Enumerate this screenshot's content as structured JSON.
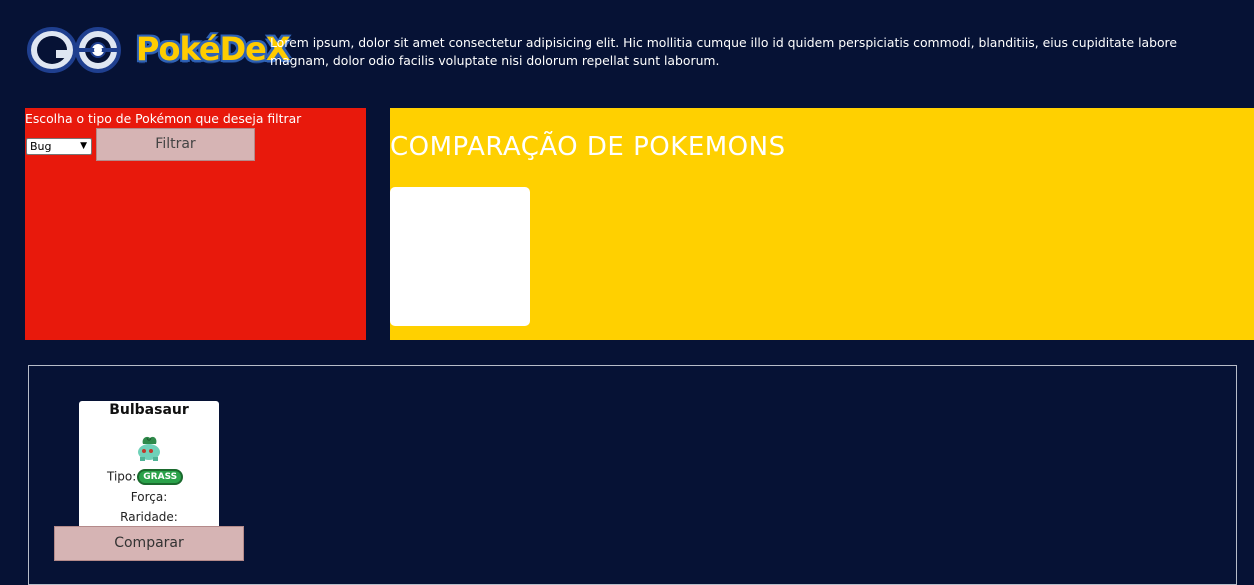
{
  "header": {
    "logo_go": "GO",
    "logo_dex": "PokéDeX",
    "intro": "Lorem ipsum, dolor sit amet consectetur adipisicing elit.  Hic mollitia cumque illo id quidem perspiciatis commodi, blanditiis, eius cupiditate labore magnam, dolor odio facilis voluptate nisi dolorum repellat sunt laborum."
  },
  "filter": {
    "label": "Escolha o tipo de  Pokémon que deseja filtrar",
    "selected_type": "Bug",
    "button_label": "Filtrar",
    "panel_color": "#e8190c"
  },
  "comparison": {
    "title": "COMPARAÇÃO DE POKEMONS",
    "panel_color": "#ffd000"
  },
  "pokemon": [
    {
      "name": "Bulbasaur",
      "icon": "bulbasaur-sprite",
      "tipo_label": "Tipo:",
      "type_badge": "GRASS",
      "forca_label": "Força:",
      "raridade_label": "Raridade:",
      "compare_label": "Comparar"
    }
  ],
  "colors": {
    "background": "#061235",
    "button": "#d6b4b4",
    "grass": "#2aa24a"
  }
}
